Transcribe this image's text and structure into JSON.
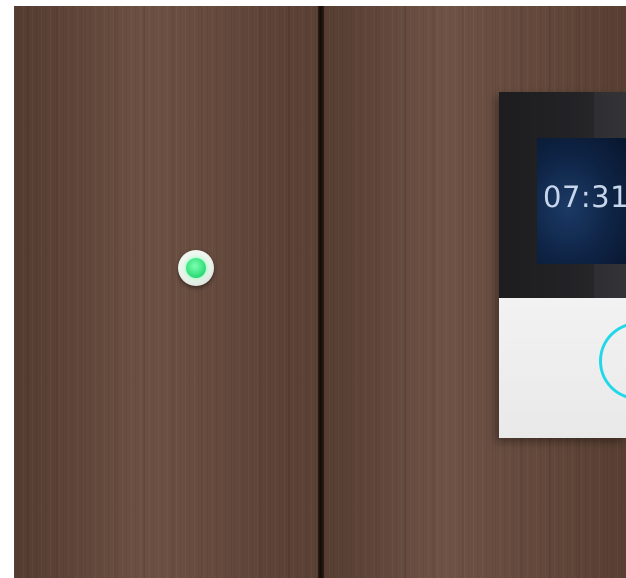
{
  "display": {
    "time": "07:31"
  },
  "indicator": {
    "status": "green",
    "color": "#35e07d"
  },
  "ring_button": {
    "color": "#22d8e8",
    "icon": "ring-icon"
  },
  "colors": {
    "wood": "#65493b",
    "seam": "#140d09",
    "panel_dark": "#232326",
    "screen": "#0e2344",
    "panel_light": "#eeeeee"
  }
}
